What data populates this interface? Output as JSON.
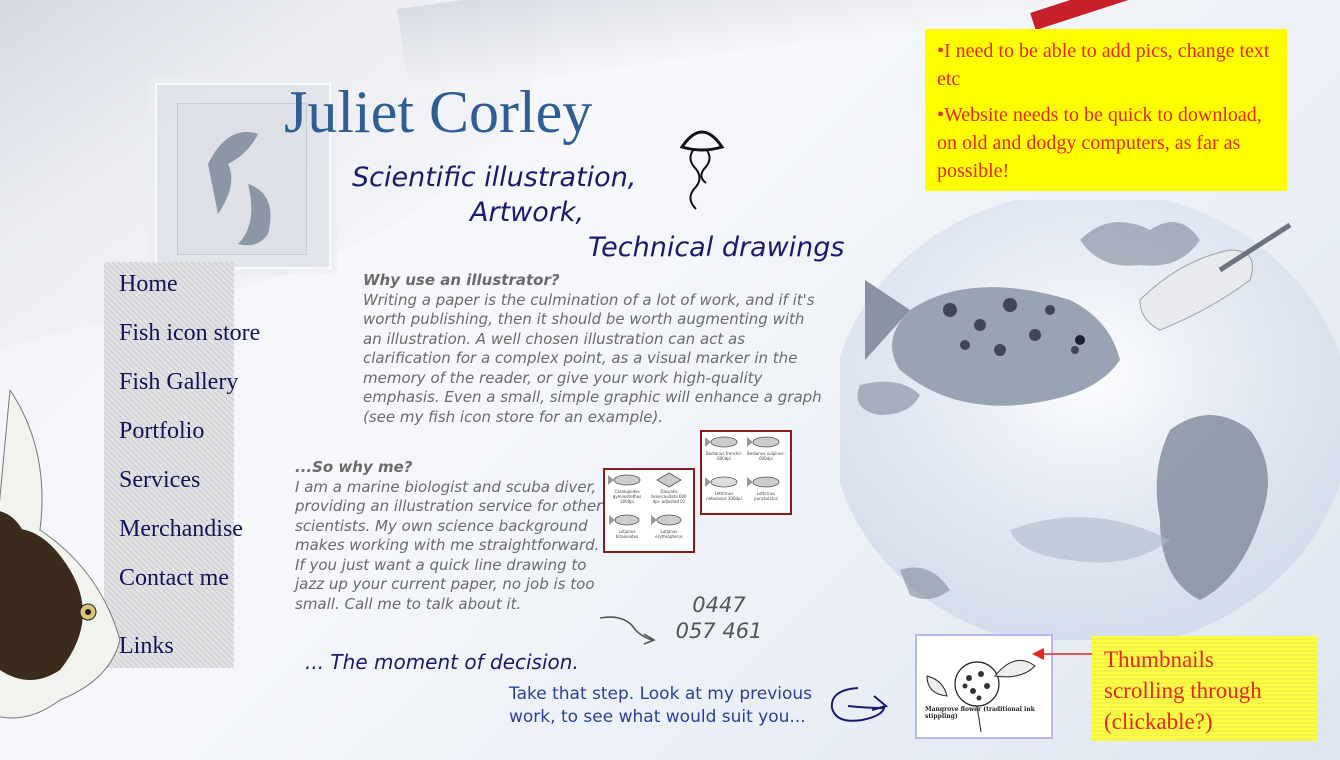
{
  "site": {
    "title": "Juliet Corley",
    "tagline_lines": [
      "Scientific illustration,",
      "Artwork,",
      "Technical drawings"
    ]
  },
  "nav": {
    "items": [
      {
        "label": "Home"
      },
      {
        "label": "Fish icon store"
      },
      {
        "label": "Fish Gallery"
      },
      {
        "label": "Portfolio"
      },
      {
        "label": "Services"
      },
      {
        "label": "Merchandise"
      },
      {
        "label": "Contact me"
      },
      {
        "label": "Links"
      }
    ]
  },
  "why_illustrator": {
    "heading": "Why use an illustrator?",
    "text": "Writing a paper is the culmination of a lot of work, and if it's worth publishing, then it should be worth augmenting with an illustration. A well chosen illustration can act as clarification for a complex point, as a visual marker in the memory of the reader, or give your work high-quality emphasis. Even a small, simple graphic will enhance a graph (see my fish icon store for an example)."
  },
  "why_me": {
    "heading": "...So why me?",
    "text": "I am a marine biologist and scuba diver, providing an illustration service for other scientists. My own science background makes working with me straightforward. If you just want a quick line drawing to jazz up your current paper, no job is too small. Call me to talk about it."
  },
  "phone": {
    "line1": "0447",
    "line2": "057 461"
  },
  "moment": "... The moment of decision.",
  "take_step": "Take that step. Look at my previous work, to see what would suit you...",
  "icon_sample_a": {
    "cells": [
      "Carangoides gymnostethus 300dpi",
      "Dasyatis brevicaudata 600 dpi- adjusted 02",
      "Lutjanus bitaeniatus",
      "Lutjanus erythropterus"
    ]
  },
  "icon_sample_b": {
    "cells": [
      "Bodianus frenchii-600dpi",
      "Bodianus vulpinus-600dpi",
      "Lethrinus nebulosus 300dpi",
      "Lethrinus punctulatus"
    ]
  },
  "thumbnail": {
    "caption": "Mangrove flower (traditional ink stippling)"
  },
  "notes": {
    "requirements": [
      "•I need to be able to add pics, change text etc",
      "•Website needs to be quick to download, on old and dodgy computers, as far as possible!"
    ],
    "thumbnails": [
      "Thumbnails",
      "scrolling through",
      "(clickable?)"
    ]
  },
  "colors": {
    "title": "#2f5e94",
    "nav_text": "#13135c",
    "note_bg": "#ffff00",
    "note_text": "#e8261e",
    "body_text": "#6b6b6b",
    "link_blue": "#2b3f9a",
    "thumb_border": "#8a1c1c"
  },
  "icons": [
    "jellyfish-sketch-icon",
    "arrow-curl-icon",
    "loop-arrow-icon",
    "red-arrow-icon"
  ]
}
